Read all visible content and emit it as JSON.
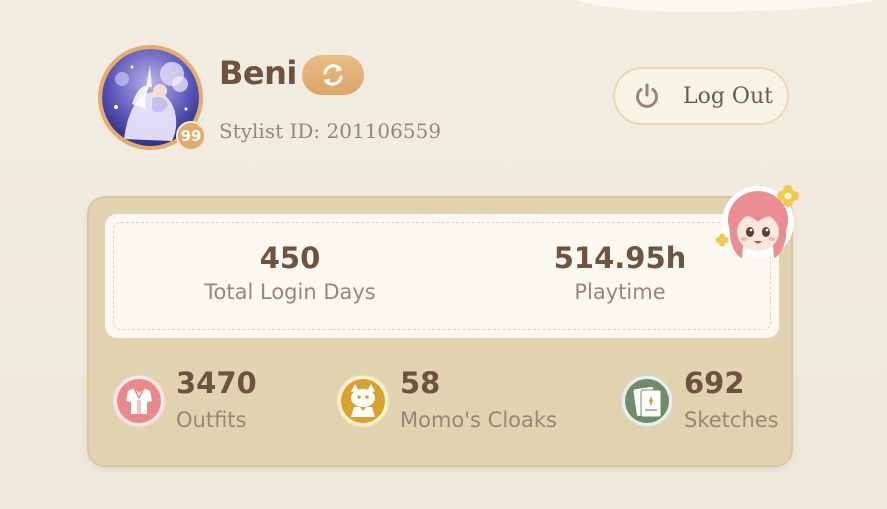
{
  "profile": {
    "username": "Beni",
    "level": "99",
    "stylist_id": "Stylist ID: 201106559"
  },
  "header": {
    "logout_label": "Log Out"
  },
  "stats": {
    "login_days": {
      "value": "450",
      "label": "Total Login Days"
    },
    "playtime": {
      "value": "514.95h",
      "label": "Playtime"
    },
    "outfits": {
      "value": "3470",
      "label": "Outfits"
    },
    "cloaks": {
      "value": "58",
      "label": "Momo's Cloaks"
    },
    "sketches": {
      "value": "692",
      "label": "Sketches"
    }
  },
  "icons": {
    "switch": "refresh-icon",
    "logout": "power-icon",
    "outfits": "outfit-icon",
    "cloaks": "momo-cloak-icon",
    "sketches": "sketch-icon"
  },
  "colors": {
    "accent": "#e0ab6c",
    "text_dark": "#6e5340",
    "text_muted": "#9a8676",
    "panel": "#e2d3b0",
    "outfit_icon": "#e8898b",
    "cloak_icon": "#d9a22e",
    "sketch_icon": "#6f8c6a"
  }
}
